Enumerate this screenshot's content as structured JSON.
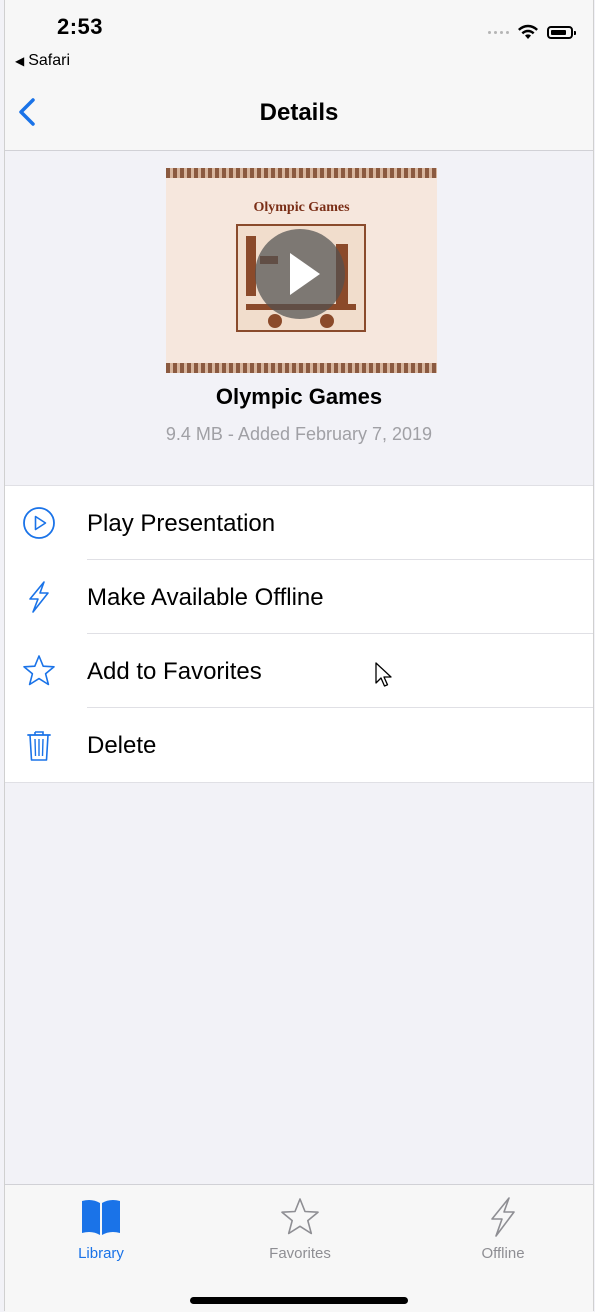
{
  "status_bar": {
    "time": "2:53",
    "back_app": "Safari"
  },
  "nav": {
    "title": "Details"
  },
  "presentation": {
    "slide_title": "Olympic Games",
    "title": "Olympic Games",
    "meta": "9.4 MB - Added February 7, 2019"
  },
  "actions": [
    {
      "label": "Play Presentation",
      "icon": "play-circle-icon"
    },
    {
      "label": "Make Available Offline",
      "icon": "lightning-icon"
    },
    {
      "label": "Add to Favorites",
      "icon": "star-icon"
    },
    {
      "label": "Delete",
      "icon": "trash-icon"
    }
  ],
  "tabs": [
    {
      "label": "Library",
      "icon": "book-icon",
      "active": true
    },
    {
      "label": "Favorites",
      "icon": "star-icon",
      "active": false
    },
    {
      "label": "Offline",
      "icon": "lightning-icon",
      "active": false
    }
  ],
  "colors": {
    "accent": "#1a73e8",
    "inactive": "#8e8e93",
    "background": "#f2f2f7"
  }
}
